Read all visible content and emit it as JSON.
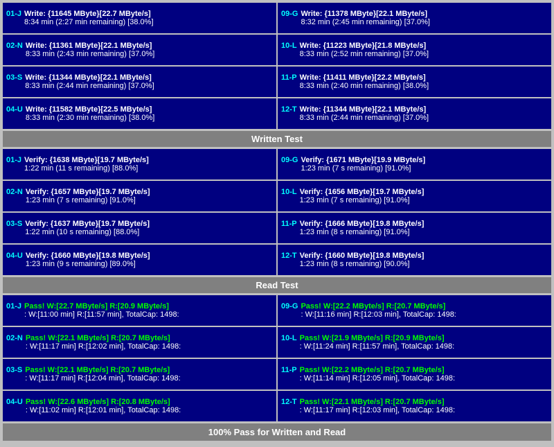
{
  "sections": {
    "written_test": {
      "label": "Written Test",
      "rows_left": [
        {
          "id": "01-J",
          "line1": "Write: {11645 MByte}[22.7 MByte/s]",
          "line2": "8:34 min (2:27 min remaining)  [38.0%]"
        },
        {
          "id": "02-N",
          "line1": "Write: {11361 MByte}[22.1 MByte/s]",
          "line2": "8:33 min (2:43 min remaining)  [37.0%]"
        },
        {
          "id": "03-S",
          "line1": "Write: {11344 MByte}[22.1 MByte/s]",
          "line2": "8:33 min (2:44 min remaining)  [37.0%]"
        },
        {
          "id": "04-U",
          "line1": "Write: {11582 MByte}[22.5 MByte/s]",
          "line2": "8:33 min (2:30 min remaining)  [38.0%]"
        }
      ],
      "rows_right": [
        {
          "id": "09-G",
          "line1": "Write: {11378 MByte}[22.1 MByte/s]",
          "line2": "8:32 min (2:45 min remaining)  [37.0%]"
        },
        {
          "id": "10-L",
          "line1": "Write: {11223 MByte}[21.8 MByte/s]",
          "line2": "8:33 min (2:52 min remaining)  [37.0%]"
        },
        {
          "id": "11-P",
          "line1": "Write: {11411 MByte}[22.2 MByte/s]",
          "line2": "8:33 min (2:40 min remaining)  [38.0%]"
        },
        {
          "id": "12-T",
          "line1": "Write: {11344 MByte}[22.1 MByte/s]",
          "line2": "8:33 min (2:44 min remaining)  [37.0%]"
        }
      ]
    },
    "verify_header": "Written Test",
    "verify": {
      "rows_left": [
        {
          "id": "01-J",
          "line1": "Verify: {1638 MByte}[19.7 MByte/s]",
          "line2": "1:22 min (11 s remaining)   [88.0%]"
        },
        {
          "id": "02-N",
          "line1": "Verify: {1657 MByte}[19.7 MByte/s]",
          "line2": "1:23 min (7 s remaining)   [91.0%]"
        },
        {
          "id": "03-S",
          "line1": "Verify: {1637 MByte}[19.7 MByte/s]",
          "line2": "1:22 min (10 s remaining)   [88.0%]"
        },
        {
          "id": "04-U",
          "line1": "Verify: {1660 MByte}[19.8 MByte/s]",
          "line2": "1:23 min (9 s remaining)   [89.0%]"
        }
      ],
      "rows_right": [
        {
          "id": "09-G",
          "line1": "Verify: {1671 MByte}[19.9 MByte/s]",
          "line2": "1:23 min (7 s remaining)   [91.0%]"
        },
        {
          "id": "10-L",
          "line1": "Verify: {1656 MByte}[19.7 MByte/s]",
          "line2": "1:23 min (7 s remaining)   [91.0%]"
        },
        {
          "id": "11-P",
          "line1": "Verify: {1666 MByte}[19.8 MByte/s]",
          "line2": "1:23 min (8 s remaining)   [91.0%]"
        },
        {
          "id": "12-T",
          "line1": "Verify: {1660 MByte}[19.8 MByte/s]",
          "line2": "1:23 min (8 s remaining)   [90.0%]"
        }
      ]
    },
    "read_test_header": "Read Test",
    "read": {
      "rows_left": [
        {
          "id": "01-J",
          "line1": "Pass! W:[22.7 MByte/s] R:[20.9 MByte/s]",
          "line2": ": W:[11:00 min] R:[11:57 min], TotalCap: 1498:"
        },
        {
          "id": "02-N",
          "line1": "Pass! W:[22.1 MByte/s] R:[20.7 MByte/s]",
          "line2": ": W:[11:17 min] R:[12:02 min], TotalCap: 1498:"
        },
        {
          "id": "03-S",
          "line1": "Pass! W:[22.1 MByte/s] R:[20.7 MByte/s]",
          "line2": ": W:[11:17 min] R:[12:04 min], TotalCap: 1498:"
        },
        {
          "id": "04-U",
          "line1": "Pass! W:[22.6 MByte/s] R:[20.8 MByte/s]",
          "line2": ": W:[11:02 min] R:[12:01 min], TotalCap: 1498:"
        }
      ],
      "rows_right": [
        {
          "id": "09-G",
          "line1": "Pass! W:[22.2 MByte/s] R:[20.7 MByte/s]",
          "line2": ": W:[11:16 min] R:[12:03 min], TotalCap: 1498:"
        },
        {
          "id": "10-L",
          "line1": "Pass! W:[21.9 MByte/s] R:[20.9 MByte/s]",
          "line2": ": W:[11:24 min] R:[11:57 min], TotalCap: 1498:"
        },
        {
          "id": "11-P",
          "line1": "Pass! W:[22.2 MByte/s] R:[20.7 MByte/s]",
          "line2": ": W:[11:14 min] R:[12:05 min], TotalCap: 1498:"
        },
        {
          "id": "12-T",
          "line1": "Pass! W:[22.1 MByte/s] R:[20.7 MByte/s]",
          "line2": ": W:[11:17 min] R:[12:03 min], TotalCap: 1498:"
        }
      ]
    },
    "footer": "100% Pass for Written and Read"
  }
}
